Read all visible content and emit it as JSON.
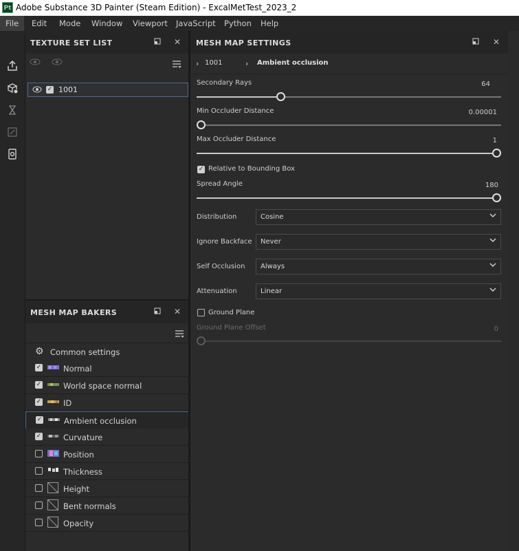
{
  "app": {
    "logo": "Pt",
    "title": "Adobe Substance 3D Painter (Steam Edition) - ExcalMetTest_2023_2"
  },
  "menu": [
    "File",
    "Edit",
    "Mode",
    "Window",
    "Viewport",
    "JavaScript",
    "Python",
    "Help"
  ],
  "texture_set_list": {
    "title": "TEXTURE SET LIST",
    "item": "1001"
  },
  "mesh_map_bakers": {
    "title": "MESH MAP BAKERS",
    "common_settings": "Common settings",
    "bakers": [
      {
        "label": "Normal",
        "checked": true
      },
      {
        "label": "World space normal",
        "checked": true
      },
      {
        "label": "ID",
        "checked": true
      },
      {
        "label": "Ambient occlusion",
        "checked": true,
        "selected": true
      },
      {
        "label": "Curvature",
        "checked": true
      },
      {
        "label": "Position",
        "checked": false
      },
      {
        "label": "Thickness",
        "checked": false
      },
      {
        "label": "Height",
        "checked": false
      },
      {
        "label": "Bent normals",
        "checked": false
      },
      {
        "label": "Opacity",
        "checked": false
      }
    ]
  },
  "mesh_map_settings": {
    "title": "MESH MAP SETTINGS",
    "breadcrumb": {
      "set": "1001",
      "map": "Ambient occlusion"
    },
    "secondary_rays": {
      "label": "Secondary Rays",
      "value": "64",
      "level": 0.27
    },
    "min_occluder": {
      "label": "Min Occluder Distance",
      "value": "0.00001",
      "level": 0.0
    },
    "max_occluder": {
      "label": "Max Occluder Distance",
      "value": "1",
      "level": 1.0
    },
    "relative_bbox": {
      "label": "Relative to Bounding Box",
      "checked": true
    },
    "spread_angle": {
      "label": "Spread Angle",
      "value": "180",
      "level": 1.0
    },
    "distribution": {
      "label": "Distribution",
      "value": "Cosine"
    },
    "ignore_backface": {
      "label": "Ignore Backface",
      "value": "Never"
    },
    "self_occlusion": {
      "label": "Self Occlusion",
      "value": "Always"
    },
    "attenuation": {
      "label": "Attenuation",
      "value": "Linear"
    },
    "ground_plane": {
      "label": "Ground Plane",
      "checked": false
    },
    "ground_plane_offset": {
      "label": "Ground Plane Offset",
      "value": "0",
      "level": 0.0
    }
  }
}
